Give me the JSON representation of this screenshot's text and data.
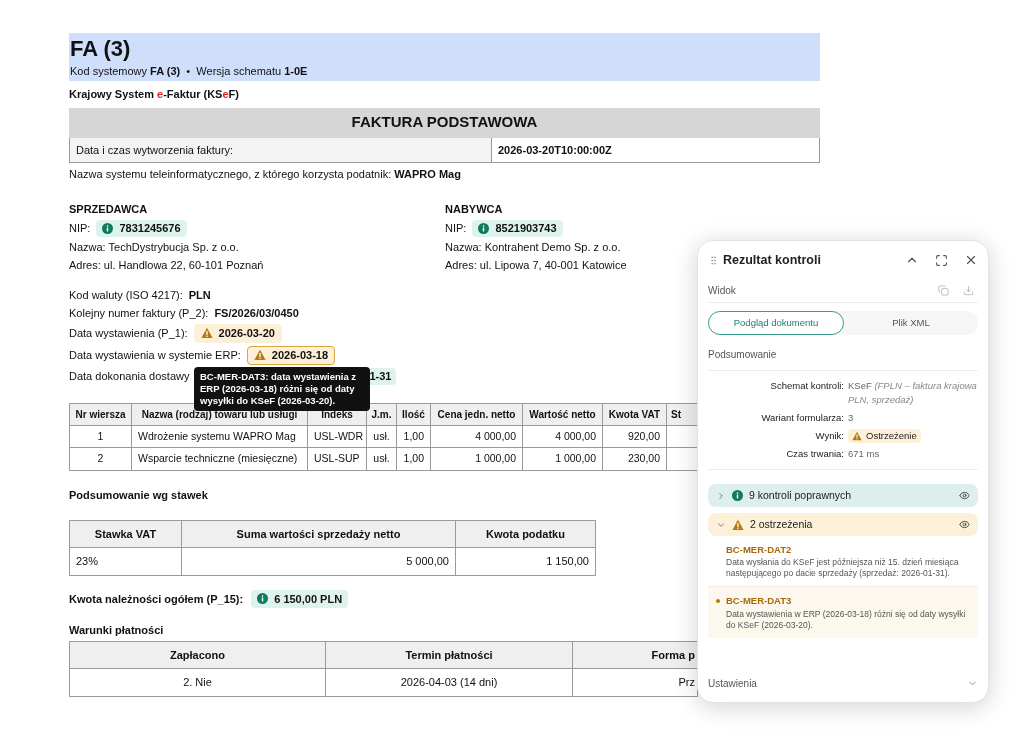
{
  "document": {
    "title": "FA (3)",
    "subtitle": "Kod systemowy **FA (3)**  •  Wersja schematu **1-0E**",
    "system": [
      {
        "text": "Krajowy System ",
        "accent": false
      },
      {
        "text": "e",
        "accent": true
      },
      {
        "text": "-Faktur (KS",
        "accent": false
      },
      {
        "text": "e",
        "accent": true
      },
      {
        "text": "F)",
        "accent": false
      }
    ],
    "heading": "FAKTURA PODSTAWOWA",
    "created": {
      "label": "Data i czas wytworzenia faktury:",
      "value": "2026-03-20T10:00:00Z"
    },
    "system_name": "Nazwa systemu teleinformatycznego, z którego korzysta podatnik: **WAPRO Mag**",
    "parties": [
      {
        "heading": "SPRZEDAWCA",
        "nip_label": "NIP:",
        "nip": "7831245676",
        "name": "Nazwa: TechDystrybucja Sp. z o.o.",
        "address": "Adres: ul. Handlowa 22, 60-101 Poznań"
      },
      {
        "heading": "NABYWCA",
        "nip_label": "NIP:",
        "nip": "8521903743",
        "name": "Nazwa: Kontrahent Demo Sp. z o.o.",
        "address": "Adres: ul. Lipowa 7, 40-001 Katowice"
      }
    ],
    "fields": [
      {
        "label": "Kod waluty (ISO 4217):",
        "value": "PLN",
        "kind": "plain"
      },
      {
        "label": "Kolejny numer faktury (P_2):",
        "value": "FS/2026/03/0450",
        "kind": "plain"
      },
      {
        "label": "Data wystawienia (P_1):",
        "value": "2026-03-20",
        "kind": "warn"
      },
      {
        "label": "Data wystawienia w systemie ERP:",
        "value": "2026-03-18",
        "kind": "warn",
        "selected": true
      },
      {
        "label": "Data dokonania dostawy",
        "value": "1-31",
        "kind": "covered"
      }
    ],
    "tooltip": "BC-MER-DAT3: data wystawienia z ERP (2026-03-18) różni się od daty wysyłki do KSeF (2026-03-20).",
    "items_table": {
      "columns": [
        "Nr wiersza",
        "Nazwa (rodzaj) towaru lub usługi",
        "Indeks",
        "J.m.",
        "Ilość",
        "Cena jedn. netto",
        "Wartość netto",
        "Kwota VAT",
        "St"
      ],
      "rows": [
        [
          "1",
          "Wdrożenie systemu WAPRO Mag",
          "USL-WDR",
          "usł.",
          "1,00",
          "4 000,00",
          "4 000,00",
          "920,00"
        ],
        [
          "2",
          "Wsparcie techniczne (miesięczne)",
          "USL-SUP",
          "usł.",
          "1,00",
          "1 000,00",
          "1 000,00",
          "230,00"
        ]
      ]
    },
    "vat_summary": {
      "title": "Podsumowanie wg stawek",
      "columns": [
        "Stawka VAT",
        "Suma wartości sprzedaży netto",
        "Kwota podatku"
      ],
      "rows": [
        [
          "23%",
          "5 000,00",
          "1 150,00"
        ]
      ]
    },
    "total": {
      "label": "Kwota należności ogółem (P_15):",
      "value": "6 150,00 PLN"
    },
    "payment": {
      "title": "Warunki płatności",
      "columns": [
        "Zapłacono",
        "Termin płatności",
        "Forma p"
      ],
      "rows": [
        [
          "2. Nie",
          "2026-04-03 (14 dni)",
          "Prz"
        ]
      ]
    }
  },
  "panel": {
    "title": "Rezultat kontroli",
    "view_label": "Widok",
    "tabs": [
      {
        "label": "Podgląd dokumentu",
        "selected": true
      },
      {
        "label": "Plik XML",
        "selected": false
      }
    ],
    "summary_title": "Podsumowanie",
    "summary": [
      {
        "label": "Schemat kontroli:",
        "value": "KSeF",
        "note": "(FPLN – faktura krajowa PLN, sprzedaż)",
        "kind": "text"
      },
      {
        "label": "Wariant formularza:",
        "value": "3",
        "kind": "text"
      },
      {
        "label": "Wynik:",
        "value": "Ostrzeżenie",
        "kind": "warn"
      },
      {
        "label": "Czas trwania:",
        "value": "671 ms",
        "kind": "text"
      }
    ],
    "groups": [
      {
        "label": "9 kontroli poprawnych",
        "kind": "ok",
        "expanded": false
      },
      {
        "label": "2 ostrzeżenia",
        "kind": "warn",
        "expanded": true,
        "items": [
          {
            "code": "BC-MER-DAT2",
            "text": "Data wysłania do KSeF jest późniejsza niż 15. dzień miesiąca następującego po dacie sprzedaży (sprzedaż: 2026-01-31).",
            "selected": false
          },
          {
            "code": "BC-MER-DAT3",
            "text": "Data wystawienia w ERP (2026-03-18) różni się od daty wysyłki do KSeF (2026-03-20).",
            "selected": true
          }
        ]
      }
    ],
    "settings_label": "Ustawienia",
    "settings_expanded": false
  }
}
